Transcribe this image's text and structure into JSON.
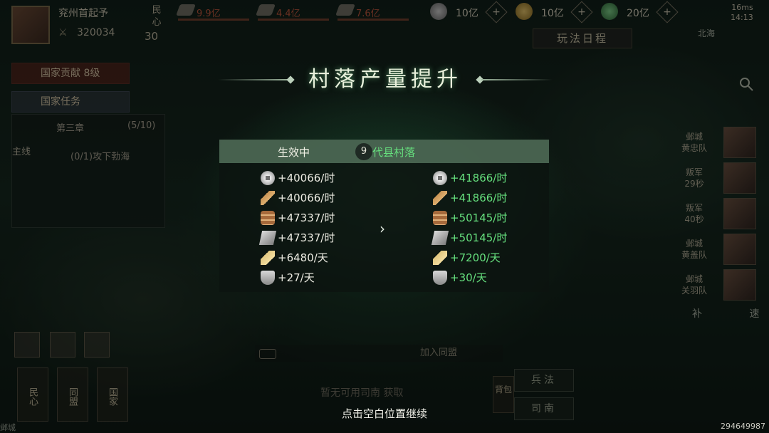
{
  "player": {
    "name": "兖州首起予",
    "power": "320034",
    "minxin_label": "民心",
    "minxin_value": "30"
  },
  "top_resources": [
    {
      "icon": "silver-icon",
      "value": "9.9亿"
    },
    {
      "icon": "wood-icon",
      "value": "4.4亿"
    },
    {
      "icon": "iron-icon",
      "value": "7.6亿"
    }
  ],
  "currencies": [
    {
      "icon": "coin-icon",
      "value": "10亿"
    },
    {
      "icon": "gold-ingot-icon",
      "value": "10亿"
    },
    {
      "icon": "jade-icon",
      "value": "20亿"
    }
  ],
  "net": {
    "latency": "16ms",
    "time": "14:13"
  },
  "left": {
    "contribution": "国家贡献  8级",
    "national_task": "国家任务",
    "quest_header": "第三章",
    "quest_progress": "(5/10)",
    "quest_item": "(0/1)攻下勃海",
    "side_tab": "主线"
  },
  "agenda_button": "玩法日程",
  "minimap_label": "北海",
  "popup": {
    "title": "村落产量提升",
    "status": "生效中",
    "level": "9",
    "village": "代县村落",
    "old": [
      {
        "icon": "coin-icon",
        "text": "+40066/时"
      },
      {
        "icon": "grain-icon",
        "text": "+40066/时"
      },
      {
        "icon": "wood-icon",
        "text": "+47337/时"
      },
      {
        "icon": "iron-icon",
        "text": "+47337/时"
      },
      {
        "icon": "feather-icon",
        "text": "+6480/天"
      },
      {
        "icon": "badge-icon",
        "text": "+27/天"
      }
    ],
    "new": [
      {
        "icon": "coin-icon",
        "text": "+41866/时"
      },
      {
        "icon": "grain-icon",
        "text": "+41866/时"
      },
      {
        "icon": "wood-icon",
        "text": "+50145/时"
      },
      {
        "icon": "iron-icon",
        "text": "+50145/时"
      },
      {
        "icon": "feather-icon",
        "text": "+7200/天"
      },
      {
        "icon": "badge-icon",
        "text": "+30/天"
      }
    ],
    "arrow": "›"
  },
  "right_queue": [
    {
      "line1": "邺城",
      "line2": "黄忠队"
    },
    {
      "line1": "叛军",
      "line2": "29秒"
    },
    {
      "line1": "叛军",
      "line2": "40秒"
    },
    {
      "line1": "邺城",
      "line2": "黄盖队"
    },
    {
      "line1": "邺城",
      "line2": "关羽队"
    }
  ],
  "bottom": {
    "join_alliance": "加入同盟",
    "no_sinan": "暂无可用司南",
    "obtain": "获取",
    "bingfa": "兵法",
    "sinan": "司南",
    "backpack": "背包",
    "tabs": [
      "民心",
      "同盟",
      "国家"
    ],
    "city": "邺城",
    "bu": "补",
    "su": "速"
  },
  "continue_hint": "点击空白位置继续",
  "uid": "294649987",
  "colors": {
    "accent_green": "#66e07e",
    "header_bg": "#789f82",
    "panel_bg": "#0c1410"
  }
}
